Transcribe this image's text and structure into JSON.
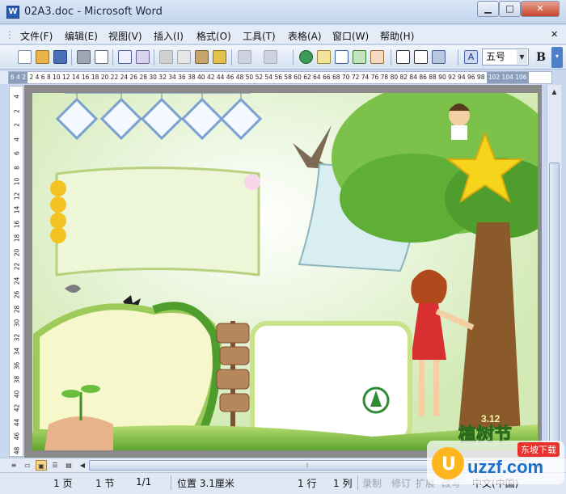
{
  "window": {
    "title": "02A3.doc - Microsoft Word",
    "icon": "W"
  },
  "menu": [
    "文件(F)",
    "编辑(E)",
    "视图(V)",
    "插入(I)",
    "格式(O)",
    "工具(T)",
    "表格(A)",
    "窗口(W)",
    "帮助(H)"
  ],
  "toolbar": {
    "font_size": "五号",
    "bold": "B"
  },
  "ruler": {
    "h_left": "6 4 2",
    "h_marks": "2 4 6 8 10 12 14 16 18 20 22 24 26 28 30 32 34 36 38 40 42 44 46 48 50 52 54 56 58 60 62 64 66 68 70 72 74 76 78 80 82 84 86 88 90 92 94 96 98",
    "h_right": "102 104 106",
    "v_marks": [
      "4",
      "2",
      "2",
      "4",
      "6",
      "8",
      "10",
      "12",
      "14",
      "16",
      "18",
      "20",
      "22",
      "24",
      "26",
      "28",
      "30",
      "32",
      "34",
      "36",
      "38",
      "40",
      "42",
      "44",
      "46",
      "48"
    ]
  },
  "poster": {
    "holiday_date": "3.12",
    "holiday_title": "植树节"
  },
  "status": {
    "page": "1 页",
    "section": "1 节",
    "pages": "1/1",
    "position": "位置 3.1厘米",
    "line": "1 行",
    "column": "1 列",
    "rec": "录制",
    "trk": "修订",
    "ext": "扩展",
    "ovr": "改写",
    "language": "中文(中国)"
  },
  "watermark": {
    "text": "uzzf.com",
    "sub": "东坡下载"
  },
  "colors": {
    "accent": "#2a5cb5",
    "leaf": "#3e8e2a",
    "star": "#f5d41c"
  }
}
